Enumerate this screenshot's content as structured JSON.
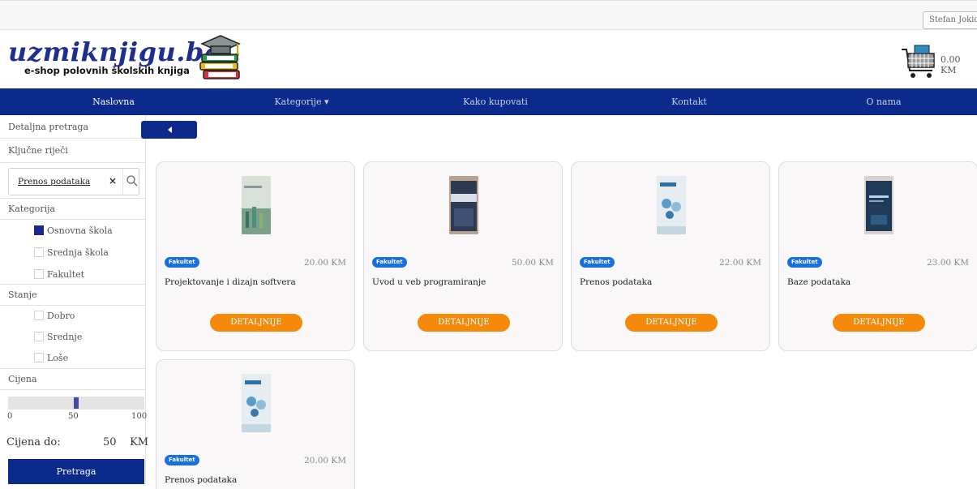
{
  "user_menu": {
    "name": "Stefan Jokic"
  },
  "header": {
    "logo_text": "uzmiknjigu.ba",
    "logo_subtitle": "e-shop polovnih školskih knjiga",
    "cart_total": "0.00 KM"
  },
  "nav": {
    "items": [
      {
        "label": "Naslovna"
      },
      {
        "label": "Kategorije ▾"
      },
      {
        "label": "Kako kupovati"
      },
      {
        "label": "Kontakt"
      },
      {
        "label": "O nama"
      }
    ]
  },
  "sidebar": {
    "detailed_search": "Detaljna pretraga",
    "keywords_label": "Ključne riječi",
    "search_value": "Prenos podataka",
    "clear_symbol": "×",
    "category_label": "Kategorija",
    "categories": [
      {
        "label": "Osnovna škola",
        "checked": true
      },
      {
        "label": "Srednja škola",
        "checked": false
      },
      {
        "label": "Fakultet",
        "checked": false
      }
    ],
    "condition_label": "Stanje",
    "conditions": [
      {
        "label": "Dobro",
        "checked": false
      },
      {
        "label": "Srednje",
        "checked": false
      },
      {
        "label": "Loše",
        "checked": false
      }
    ],
    "price_label": "Cijena",
    "slider": {
      "min": "0",
      "mid": "50",
      "max": "100",
      "value": 50
    },
    "price_up_to_label": "Cijena do:",
    "price_up_to_value": "50",
    "price_currency": "KM",
    "search_button": "Pretraga"
  },
  "products": [
    {
      "badge": "Fakultet",
      "price": "20.00 KM",
      "title": "Projektovanje i dizajn softvera",
      "details": "DETALJNIJE"
    },
    {
      "badge": "Fakultet",
      "price": "50.00 KM",
      "title": "Uvod u veb programiranje",
      "details": "DETALJNIJE"
    },
    {
      "badge": "Fakultet",
      "price": "22.00 KM",
      "title": "Prenos podataka",
      "details": "DETALJNIJE"
    },
    {
      "badge": "Fakultet",
      "price": "23.00 KM",
      "title": "Baze podataka",
      "details": "DETALJNIJE"
    },
    {
      "badge": "Fakultet",
      "price": "20.00 KM",
      "title": "Prenos podataka"
    }
  ],
  "colors": {
    "brand": "#0b2a8c",
    "accent": "#f5890a",
    "badge": "#1a6fe0"
  }
}
